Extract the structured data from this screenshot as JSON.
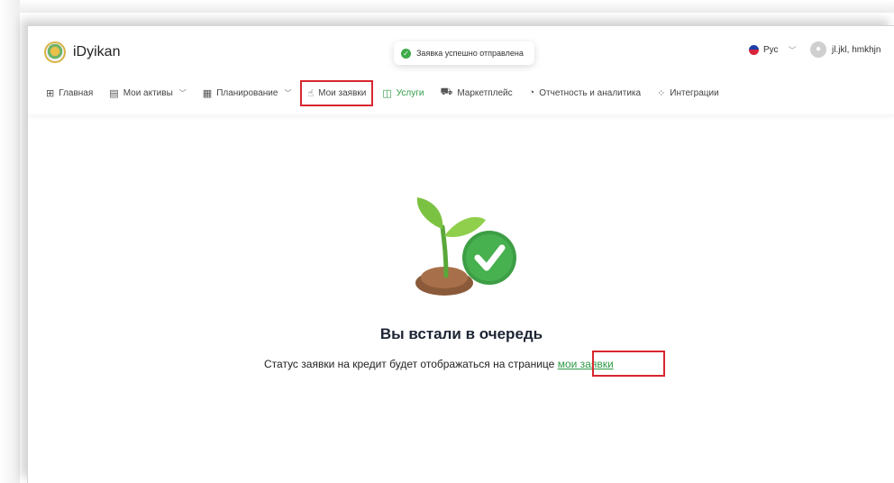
{
  "header": {
    "brand": "iDyikan",
    "toast_message": "Заявка успешно отправлена",
    "language": "Рус",
    "user_name": "jl.jkl, hmkhjn"
  },
  "nav": {
    "items": [
      {
        "label": "Главная",
        "icon": "grid-icon"
      },
      {
        "label": "Мои активы",
        "icon": "document-icon",
        "dropdown": true
      },
      {
        "label": "Планирование",
        "icon": "calendar-icon",
        "dropdown": true
      },
      {
        "label": "Мои заявки",
        "icon": "hand-coins-icon",
        "highlighted": true
      },
      {
        "label": "Услуги",
        "icon": "bag-icon",
        "active": true
      },
      {
        "label": "Маркетплейс",
        "icon": "cart-icon"
      },
      {
        "label": "Отчетность и аналитика",
        "icon": "pie-chart-icon"
      },
      {
        "label": "Интеграции",
        "icon": "integration-icon"
      }
    ]
  },
  "main": {
    "title": "Вы встали в очередь",
    "subtitle_text": "Статус заявки на кредит будет отображаться на странице",
    "subtitle_link": "мои заявки"
  },
  "colors": {
    "accent_green": "#2e9a44",
    "highlight_red": "#d8262f"
  }
}
